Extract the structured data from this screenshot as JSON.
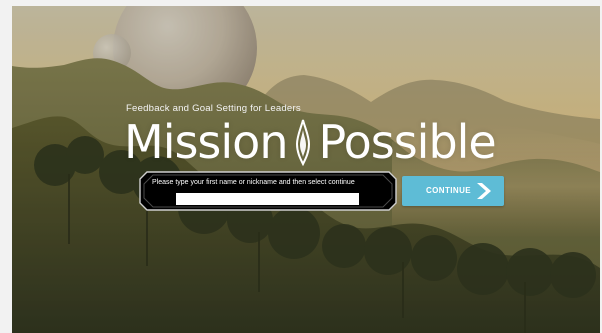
{
  "header": {
    "subtitle": "Feedback and Goal Setting for Leaders",
    "brand_left": "Mission",
    "brand_right": "Possible",
    "logo_icon": "flame-icon"
  },
  "entry": {
    "prompt": "Please type your first name or nickname and then select continue",
    "name_value": ""
  },
  "actions": {
    "continue_label": "CONTINUE",
    "continue_icon": "chevron-right-icon"
  },
  "colors": {
    "button": "#5ebcd6",
    "panel": "#000000",
    "sky": "#f0b36a"
  }
}
